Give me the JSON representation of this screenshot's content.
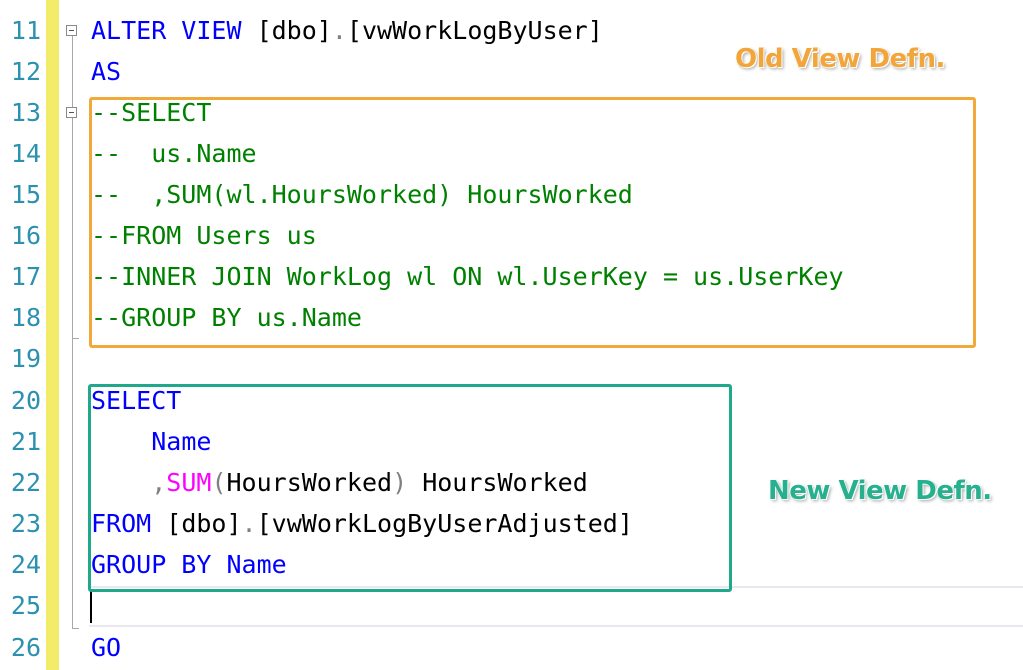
{
  "colors": {
    "keyword": "#0000ff",
    "comment": "#008000",
    "function": "#ff00ff",
    "operator_gray": "#808080",
    "line_number": "#2b91af",
    "change_bar": "#f2ec6a",
    "old_box": "#f3a93a",
    "new_box": "#1fa88a"
  },
  "annotations": {
    "old_view": "Old View Defn.",
    "new_view": "New View Defn."
  },
  "line_numbers": [
    "11",
    "12",
    "13",
    "14",
    "15",
    "16",
    "17",
    "18",
    "19",
    "20",
    "21",
    "22",
    "23",
    "24",
    "25",
    "26"
  ],
  "code": {
    "l11": {
      "alter_view": "ALTER VIEW",
      "sp": " ",
      "schema": "[dbo]",
      "dot": ".",
      "name": "[vwWorkLogByUser]"
    },
    "l12": {
      "as": "AS"
    },
    "l13": {
      "text": "--SELECT"
    },
    "l14": {
      "text": "--  us.Name"
    },
    "l15": {
      "text": "--  ,SUM(wl.HoursWorked) HoursWorked"
    },
    "l16": {
      "text": "--FROM Users us"
    },
    "l17": {
      "text": "--INNER JOIN WorkLog wl ON wl.UserKey = us.UserKey"
    },
    "l18": {
      "text": "--GROUP BY us.Name"
    },
    "l20": {
      "select": "SELECT"
    },
    "l21": {
      "indent": "    ",
      "name": "Name"
    },
    "l22": {
      "indent": "    ",
      "comma": ",",
      "sum": "SUM",
      "open": "(",
      "arg": "HoursWorked",
      "close": ")",
      "alias": " HoursWorked"
    },
    "l23": {
      "from": "FROM",
      "sp": " ",
      "schema": "[dbo]",
      "dot": ".",
      "name": "[vwWorkLogByUserAdjusted]"
    },
    "l24": {
      "group_by": "GROUP BY",
      "sp": " ",
      "name": "Name"
    },
    "l26": {
      "go": "GO"
    }
  }
}
